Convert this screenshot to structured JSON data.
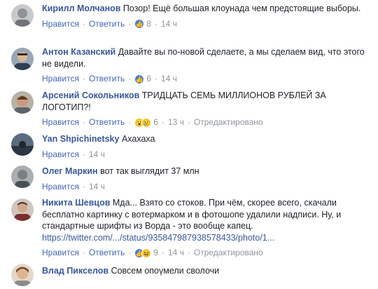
{
  "comments": [
    {
      "author": "Кирилл Молчанов",
      "text": "Позор! Ещё большая клоунада чем предстоящие выборы.",
      "like_label": "Нравится",
      "reply_label": "Ответить",
      "reactions": [
        "like"
      ],
      "reaction_count": "8",
      "time": "14 ч",
      "edited": ""
    },
    {
      "author": "Антон Казанский",
      "text": "Давайте вы по-новой сделаете, а мы сделаем вид, что этого не видели.",
      "like_label": "Нравится",
      "reply_label": "Ответить",
      "reactions": [
        "like"
      ],
      "reaction_count": "6",
      "time": "14 ч",
      "edited": ""
    },
    {
      "author": "Арсений Сокольников",
      "text": "ТРИДЦАТЬ СЕМЬ МИЛЛИОНОВ РУБЛЕЙ ЗА ЛОГОТИП?!",
      "like_label": "Нравится",
      "reply_label": "Ответить",
      "reactions": [
        "wow",
        "sad"
      ],
      "reaction_count": "6",
      "time": "13 ч",
      "edited": "Отредактировано"
    },
    {
      "author": "Yan Shpichinetsky",
      "text": "Ахахаха",
      "like_label": "Нравится",
      "reply_label": "",
      "reactions": [],
      "reaction_count": "",
      "time": "14 ч",
      "edited": ""
    },
    {
      "author": "Олег Маркин",
      "text": "вот так выглядит 37 млн",
      "like_label": "Нравится",
      "reply_label": "",
      "reactions": [],
      "reaction_count": "",
      "time": "14 ч",
      "edited": ""
    },
    {
      "author": "Никита Шевцов",
      "text": "Мда... Взято со стоков. При чём, скорее всего, скачали бесплатно картинку с вотермарком и в фотошопе удалили надписи. Ну, и стандартные шрифты из Ворда - это вообще капец.",
      "url": "https://twitter.com/.../status/935847987938578433/photo/1...",
      "like_label": "Нравится",
      "reply_label": "Ответить",
      "reactions": [
        "like",
        "haha"
      ],
      "reaction_count": "9",
      "time": "14 ч",
      "edited": "Отредактировано"
    },
    {
      "author": "Влад Пикселов",
      "text": "Совсем опоүмели сволочи",
      "like_label": "",
      "reply_label": "",
      "reactions": [],
      "reaction_count": "",
      "time": "",
      "edited": ""
    }
  ],
  "colors": {
    "author": "#385898",
    "action_link": "#4267b2",
    "meta": "#90949c",
    "like_reaction": "#4a7ed8",
    "emoji_reaction": "#f7c436"
  }
}
